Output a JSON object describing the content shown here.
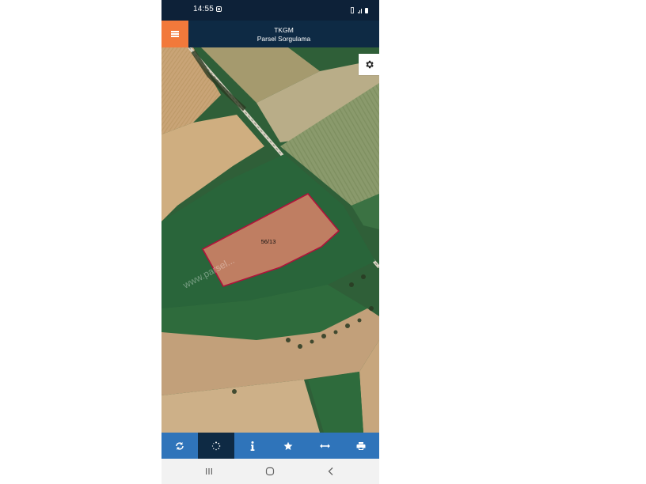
{
  "status_bar": {
    "time": "14:55",
    "icons": [
      "instagram-icon",
      "vibrate-icon",
      "signal-icon",
      "battery-icon"
    ]
  },
  "header": {
    "title": "TKGM",
    "subtitle": "Parsel Sorgulama",
    "menu_icon": "hamburger-menu-icon",
    "brand_color": "#f2793b",
    "bar_color": "#0e2a44"
  },
  "map": {
    "parcel_label": "56/13",
    "watermark": "www.parsel...",
    "settings_icon": "gear-icon"
  },
  "toolbar": {
    "color": "#2f74ba",
    "active_index": 1,
    "buttons": [
      "refresh-icon",
      "loading-icon",
      "info-icon",
      "star-icon",
      "measure-icon",
      "print-icon"
    ]
  },
  "nav_bar": {
    "buttons": [
      "recent-apps-icon",
      "home-icon",
      "back-icon"
    ]
  }
}
